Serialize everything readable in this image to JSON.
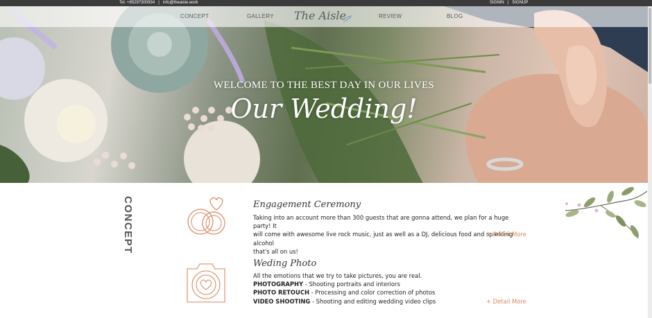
{
  "topbar": {
    "phone": "Tel. +85297300934",
    "email": "info@theaisle.work",
    "signin": "SIGNIN",
    "signup": "SIGNUP"
  },
  "nav": {
    "items": [
      "CONCEPT",
      "GALLERY",
      "REVIEW",
      "BLOG"
    ],
    "logo": "The Aisle"
  },
  "hero": {
    "subtitle": "WELCOME TO THE BEST DAY IN OUR LIVES",
    "title": "Our Wedding!"
  },
  "concept": {
    "section_label": "CONCEPT",
    "services": [
      {
        "title": "Engagement Ceremony",
        "lines": [
          "Taking into an account more than 300 guests that are gonna attend, we plan for a huge party! It",
          "will come with awesome live rock music, just as well as a DJ, delicious food and sparkling alcohol",
          "that's all on us!"
        ],
        "detail": "+ Detail More",
        "icon": "rings-heart-icon"
      },
      {
        "title": "Weding Photo",
        "intro": "All the emotions that we try to take pictures, you are real.",
        "items": [
          {
            "label": "PHOTOGRAPHY",
            "desc": " - Shooting portraits and interiors"
          },
          {
            "label": "PHOTO RETOUCH",
            "desc": " - Processing and color correction of photos"
          },
          {
            "label": "VIDEO SHOOTING",
            "desc": " - Shooting and editing wedding video clips"
          }
        ],
        "detail": "+ Detail More",
        "icon": "camera-heart-icon"
      }
    ]
  },
  "colors": {
    "accent": "#d9865e",
    "topbar": "#3b3b3b"
  }
}
